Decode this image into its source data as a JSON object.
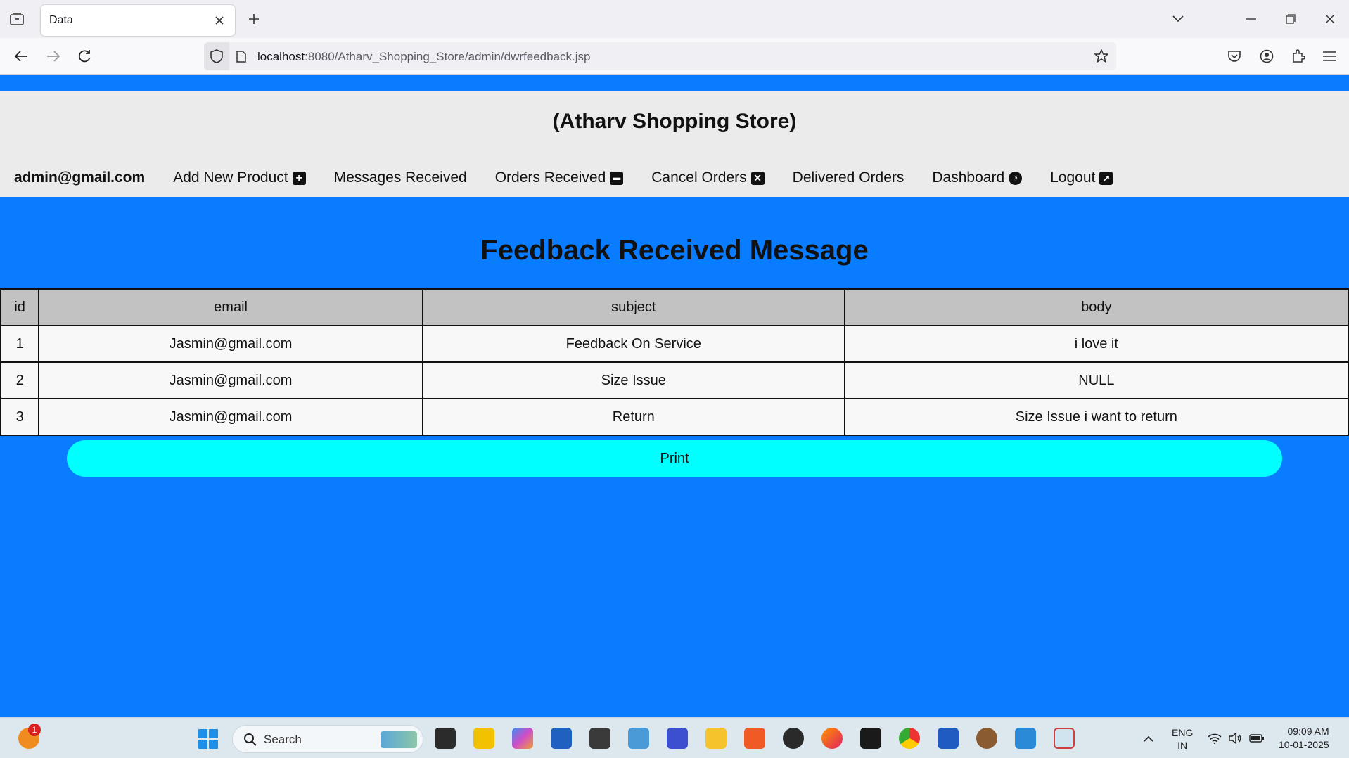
{
  "browser": {
    "tab_title": "Data",
    "url_host": "localhost",
    "url_rest": ":8080/Atharv_Shopping_Store/admin/dwrfeedback.jsp"
  },
  "header": {
    "store_title": "(Atharv Shopping Store)",
    "menu": {
      "email": "admin@gmail.com",
      "add_product": "Add New Product",
      "messages": "Messages Received",
      "orders": "Orders Received",
      "cancel": "Cancel Orders",
      "delivered": "Delivered Orders",
      "dashboard": "Dashboard",
      "logout": "Logout"
    }
  },
  "main": {
    "title": "Feedback Received Message",
    "table": {
      "columns": [
        "id",
        "email",
        "subject",
        "body"
      ],
      "rows": [
        [
          "1",
          "Jasmin@gmail.com",
          "Feedback On Service",
          "i love it"
        ],
        [
          "2",
          "Jasmin@gmail.com",
          "Size Issue",
          "NULL"
        ],
        [
          "3",
          "Jasmin@gmail.com",
          "Return",
          "Size Issue i want to return"
        ]
      ]
    },
    "print_label": "Print"
  },
  "taskbar": {
    "notification_count": "1",
    "search_label": "Search",
    "lang_line1": "ENG",
    "lang_line2": "IN",
    "time": "09:09 AM",
    "date": "10-01-2025"
  },
  "colors": {
    "page_bg": "#0a7cff",
    "header_bg": "#ebebeb",
    "print_button": "#00ffff",
    "table_header_bg": "#c2c2c2"
  }
}
